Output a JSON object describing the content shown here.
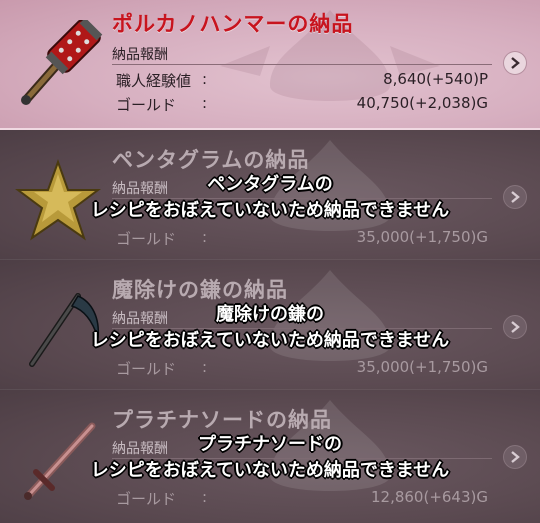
{
  "items": [
    {
      "title": "ポルカノハンマーの納品",
      "reward_header": "納品報酬",
      "rows": [
        {
          "label": "職人経験値",
          "colon": ":",
          "value": "8,640(+540)P"
        },
        {
          "label": "ゴールド",
          "colon": ":",
          "value": "40,750(+2,038)G"
        }
      ],
      "icon": "hammer-icon",
      "state": "active",
      "overlay": []
    },
    {
      "title": "ペンタグラムの納品",
      "reward_header": "納品報酬",
      "rows": [
        {
          "label": "ゴールド",
          "colon": ":",
          "value": "35,000(+1,750)G"
        }
      ],
      "icon": "pentagram-star-icon",
      "state": "disabled",
      "overlay": [
        "ペンタグラムの",
        "レシピをおぼえていないため納品できません"
      ]
    },
    {
      "title": "魔除けの鎌の納品",
      "reward_header": "納品報酬",
      "rows": [
        {
          "label": "ゴールド",
          "colon": ":",
          "value": "35,000(+1,750)G"
        }
      ],
      "icon": "scythe-icon",
      "state": "disabled",
      "overlay": [
        "魔除けの鎌の",
        "レシピをおぼえていないため納品できません"
      ]
    },
    {
      "title": "プラチナソードの納品",
      "reward_header": "納品報酬",
      "rows": [
        {
          "label": "ゴールド",
          "colon": ":",
          "value": "12,860(+643)G"
        }
      ],
      "icon": "sword-icon",
      "state": "disabled",
      "overlay": [
        "プラチナソードの",
        "レシピをおぼえていないため納品できません"
      ]
    }
  ],
  "colors": {
    "active_title": "#c8141e",
    "active_bg": "#d6aebf",
    "disabled_bg": "#5a4950"
  }
}
